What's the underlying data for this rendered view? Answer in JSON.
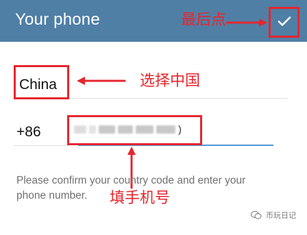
{
  "header": {
    "title": "Your phone",
    "confirm_icon": "check-icon"
  },
  "form": {
    "country": "China",
    "country_code": "+86",
    "phone_value_visible": ")",
    "help_text": "Please confirm your country code and enter your phone number."
  },
  "annotations": {
    "last_click": "最后点",
    "choose_china": "选择中国",
    "fill_phone": "填手机号"
  },
  "watermark": {
    "text": "币玩日记"
  },
  "colors": {
    "header_bg": "#507fa6",
    "accent_blue": "#4f98d6",
    "annotation_red": "#e5262d"
  }
}
